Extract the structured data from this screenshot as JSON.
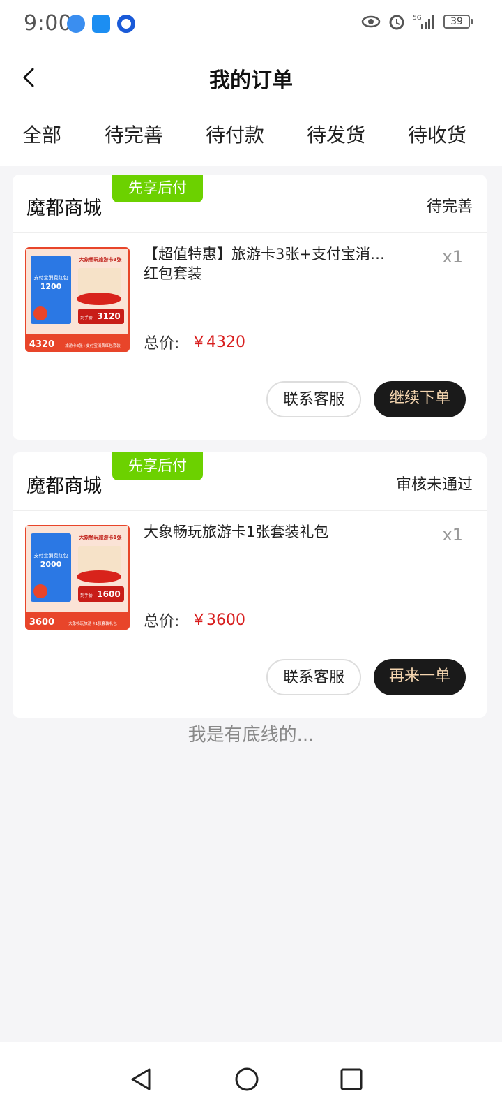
{
  "status_bar": {
    "time": "9:00",
    "battery": "39",
    "icons": [
      "browser-icon",
      "message-icon",
      "app-circle-icon",
      "eye-icon",
      "alarm-icon",
      "5g-signal-icon",
      "battery-icon"
    ]
  },
  "header": {
    "title": "我的订单"
  },
  "tabs": [
    {
      "label": "全部"
    },
    {
      "label": "待完善"
    },
    {
      "label": "待付款"
    },
    {
      "label": "待发货"
    },
    {
      "label": "待收货"
    }
  ],
  "orders": [
    {
      "shop": "魔都商城",
      "badge": "先享后付",
      "status": "待完善",
      "product_name": "【超值特惠】旅游卡3张+支付宝消…\n红包套装",
      "quantity": "x1",
      "total_label": "总价:",
      "total_value": "￥4320",
      "thumb": {
        "title": "大象畅玩旅游卡3张",
        "coupon_top": "支付宝消费红包",
        "coupon_amount": "1200",
        "price_tag": "3120",
        "price_badge": "到手价",
        "origin_price": "4320",
        "footer": "旅游卡3张+支付宝消费红包套装"
      },
      "buttons": {
        "service": "联系客服",
        "primary": "继续下单"
      }
    },
    {
      "shop": "魔都商城",
      "badge": "先享后付",
      "status": "审核未通过",
      "product_name": "大象畅玩旅游卡1张套装礼包",
      "quantity": "x1",
      "total_label": "总价:",
      "total_value": "￥3600",
      "thumb": {
        "title": "大象畅玩旅游卡1张",
        "coupon_top": "支付宝消费红包",
        "coupon_amount": "2000",
        "price_tag": "1600",
        "price_badge": "到手价",
        "origin_price": "3600",
        "footer": "大象畅玩旅游卡1张套装礼包"
      },
      "buttons": {
        "service": "联系客服",
        "primary": "再来一单"
      }
    }
  ],
  "footer_text": "我是有底线的..."
}
